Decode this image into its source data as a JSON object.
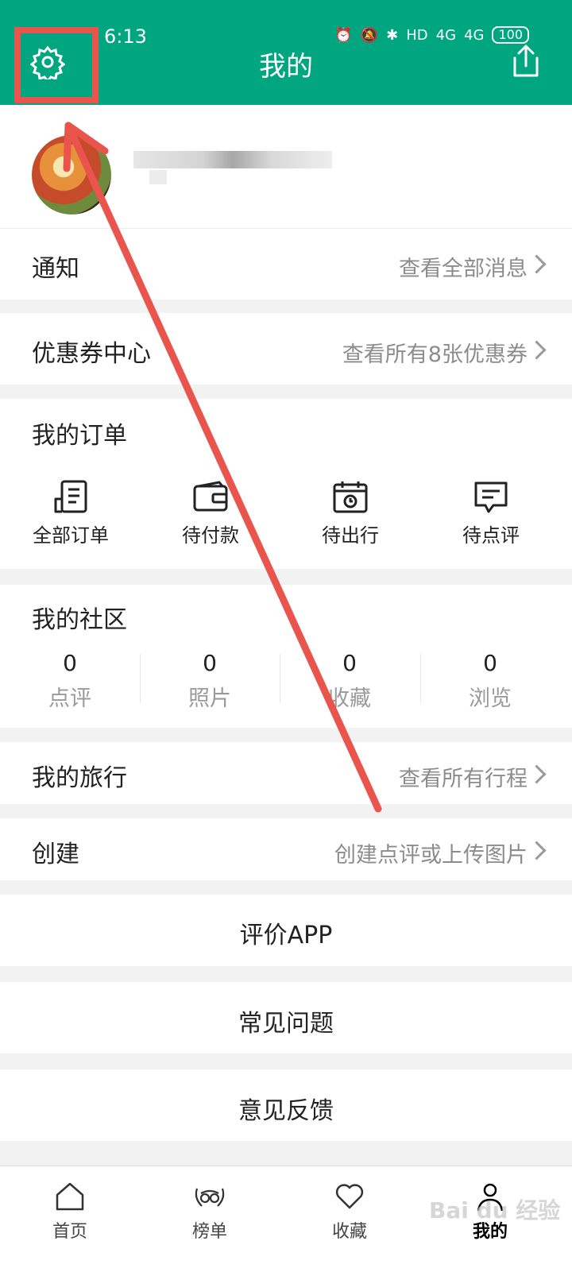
{
  "status": {
    "time": "6:13",
    "network1": "4G",
    "network2": "4G",
    "hd": "HD",
    "battery": "100"
  },
  "header": {
    "title": "我的"
  },
  "notifications": {
    "title": "通知",
    "link": "查看全部消息"
  },
  "coupons": {
    "title": "优惠券中心",
    "link": "查看所有8张优惠券"
  },
  "orders": {
    "title": "我的订单",
    "items": [
      {
        "label": "全部订单",
        "icon": "document-list-icon"
      },
      {
        "label": "待付款",
        "icon": "wallet-icon"
      },
      {
        "label": "待出行",
        "icon": "calendar-clock-icon"
      },
      {
        "label": "待点评",
        "icon": "chat-bubble-icon"
      }
    ]
  },
  "community": {
    "title": "我的社区",
    "stats": [
      {
        "value": "0",
        "label": "点评"
      },
      {
        "value": "0",
        "label": "照片"
      },
      {
        "value": "0",
        "label": "收藏"
      },
      {
        "value": "0",
        "label": "浏览"
      }
    ]
  },
  "travel": {
    "title": "我的旅行",
    "link": "查看所有行程"
  },
  "create": {
    "title": "创建",
    "link": "创建点评或上传图片"
  },
  "menu": {
    "rate": "评价APP",
    "faq": "常见问题",
    "feedback": "意见反馈"
  },
  "tabbar": {
    "tabs": [
      {
        "label": "首页",
        "icon": "home-icon"
      },
      {
        "label": "榜单",
        "icon": "owl-laurel-icon"
      },
      {
        "label": "收藏",
        "icon": "heart-icon"
      },
      {
        "label": "我的",
        "icon": "person-icon"
      }
    ],
    "active": "我的"
  },
  "watermark": "Bai du 经验",
  "colors": {
    "brand_green": "#00a680",
    "annotation_red": "#e9544d"
  }
}
